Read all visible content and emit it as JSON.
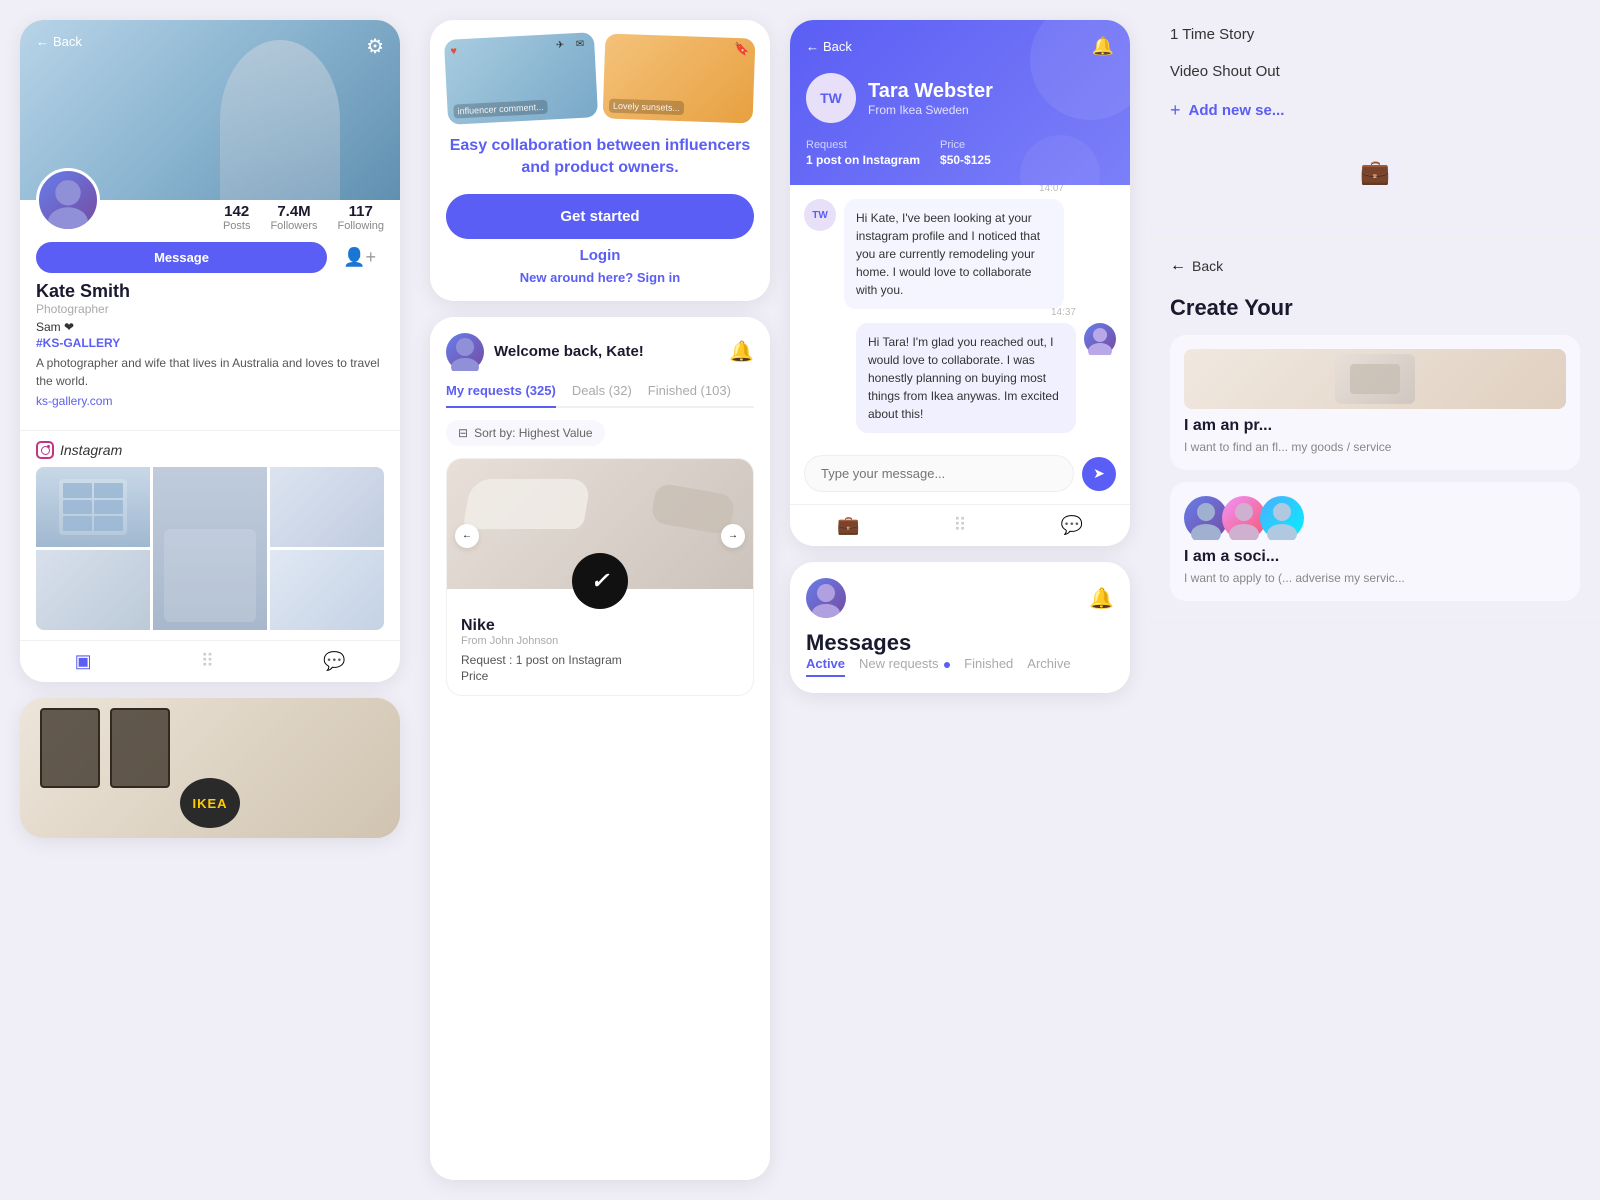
{
  "app": {
    "background": "#f0eef6"
  },
  "profile_card": {
    "back_label": "Back",
    "name": "Kate Smith",
    "role": "Photographer",
    "tag": "Sam ❤",
    "hashtag": "#KS-GALLERY",
    "bio": "A photographer and wife that lives in Australia and loves to travel the world.",
    "website": "ks-gallery.com",
    "stats": {
      "posts": "142",
      "posts_label": "Posts",
      "followers": "7.4M",
      "followers_label": "Followers",
      "following": "117",
      "following_label": "Following"
    },
    "message_btn": "Message",
    "instagram_label": "Instagram"
  },
  "collaboration_card": {
    "text_normal": "between influencers and product owners.",
    "text_colored": "Easy collaboration",
    "get_started_btn": "Get started",
    "login_btn": "Login",
    "sign_in_text": "New around here?",
    "sign_in_link": "Sign in"
  },
  "requests_card": {
    "welcome_text": "Welcome back, Kate!",
    "tabs": [
      {
        "label": "My requests (325)",
        "active": true
      },
      {
        "label": "Deals (32)",
        "active": false
      },
      {
        "label": "Finished (103)",
        "active": false
      }
    ],
    "sort_label": "Sort by: Highest Value",
    "nike_brand": "Nike",
    "nike_from": "From John Johnson",
    "nike_request": "Request : 1 post on Instagram",
    "nike_price_label": "Price"
  },
  "chat_card": {
    "back_label": "Back",
    "name": "Tara Webster",
    "location": "From Ikea Sweden",
    "request_label": "Request",
    "request_value": "1 post on Instagram",
    "price_label": "Price",
    "price_value": "$50-$125",
    "messages": [
      {
        "sender": "TW",
        "time": "14:07",
        "text": "Hi Kate, I've been looking at your instagram profile and I noticed that you are currently remodeling your home. I would love to collaborate with you.",
        "self": false
      },
      {
        "sender": "me",
        "time": "14:37",
        "text": "Hi Tara! I'm glad you reached out, I would love to collaborate. I was honestly planning on buying most things from Ikea anywas. Im excited about this!",
        "self": true
      }
    ],
    "input_placeholder": "Type your message...",
    "send_icon": "➤"
  },
  "messages_bottom_card": {
    "title": "Messages",
    "avatar_bell": true,
    "tabs": [
      {
        "label": "Active",
        "active": true
      },
      {
        "label": "New requests",
        "dot": true,
        "active": false
      },
      {
        "label": "Finished",
        "active": false
      },
      {
        "label": "Archive",
        "active": false
      }
    ]
  },
  "sidebar": {
    "items": [
      {
        "label": "1 Time Story",
        "active": false
      },
      {
        "label": "Video Shout Out",
        "active": false
      },
      {
        "label": "Add new se...",
        "is_add": true
      }
    ],
    "create_title": "Create Your",
    "roles": [
      {
        "title": "I am an pr...",
        "desc": "I want to find an fl... my goods / service"
      },
      {
        "title": "I am a soci...",
        "desc": "I want to apply to (... adverise my servic..."
      }
    ]
  }
}
